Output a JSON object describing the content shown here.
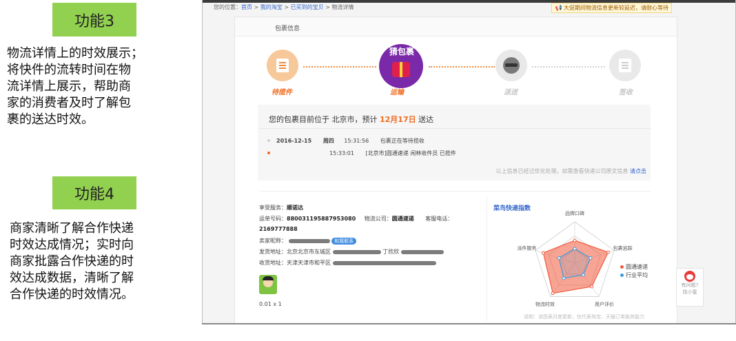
{
  "slides": {
    "feature3": {
      "badge": "功能3",
      "lines": [
        "物流详情上的时效展示；",
        "将快件的流转时间在物",
        "流详情上展示，帮助商",
        "家的消费者及时了解包",
        "裹的送达时效。"
      ]
    },
    "feature4": {
      "badge": "功能4",
      "lines": [
        "商家清晰了解合作快递",
        "时效达成情况；实时向",
        "商家批露合作快递的时",
        "效达成数据，清晰了解",
        "合作快递的时效情况。"
      ]
    }
  },
  "screenshot": {
    "breadcrumb": {
      "prefix": "您的位置：",
      "home": "首页",
      "sep": " > ",
      "mytaobao": "我的淘宝",
      "bought": "已买到的宝贝",
      "current": "物流详情"
    },
    "notice": "大促期间物流信息更新较延迟，请耐心等待",
    "panel_title": "包裹信息",
    "steps": [
      {
        "label": "待揽件",
        "state": "done",
        "icon": "clipboard-icon"
      },
      {
        "label": "运输",
        "state": "current",
        "icon": "gift-package-icon",
        "title": "猜包裹"
      },
      {
        "label": "派送",
        "state": "pending",
        "icon": "courier-icon"
      },
      {
        "label": "签收",
        "state": "pending",
        "icon": "signed-document-icon"
      }
    ],
    "eta": {
      "prefix": "您的包裹目前位于 北京市，预计 ",
      "date": "12月17日",
      "suffix": " 送达"
    },
    "tracking": [
      {
        "date": "2016-12-15",
        "weekday": "周四",
        "time": "15:31:56",
        "event": "包裹正在等待揽收"
      },
      {
        "date": "",
        "weekday": "",
        "time": "15:33:01",
        "event": "[北京市]圆通速递 闲林收件员 已揽件"
      }
    ],
    "tracking_note": "以上信息已经过优化处理，如需查看快递公司原文信息",
    "tracking_note_link": "请点击",
    "info": {
      "service_label": "享受服务：",
      "service_value": "顺诺达",
      "waybill_label": "运单号码：",
      "waybill_value": "880031195887953080",
      "company_label": "物流公司：",
      "company_value": "圆通速递",
      "phone_label": "客服电话：",
      "phone_value": "2169777888",
      "seller_label": "卖家昵称：",
      "contact_pill": "和我联系",
      "ship_label": "发货地址：",
      "ship_value": "北京北京市东城区",
      "ship_contact": "丁欣欣",
      "recv_label": "收货地址：",
      "recv_value": "天津天津市和平区",
      "qty": "0.01 x 1"
    },
    "radar": {
      "title": "菜鸟快递指数",
      "axes": [
        "品牌口碑",
        "包裹追踪",
        "用户评价",
        "物流时效",
        "派件服务"
      ],
      "series": [
        {
          "name": "圆通速递",
          "color": "#f05a3c",
          "values": [
            0.55,
            0.85,
            0.7,
            0.9,
            0.8
          ]
        },
        {
          "name": "行业平均",
          "color": "#3b9ad9",
          "values": [
            0.35,
            0.4,
            0.35,
            0.45,
            0.4
          ]
        }
      ],
      "footnote": "说明：该图表月度更新，仅代表淘宝、天猫订单服务能力"
    },
    "help": {
      "line1": "有问题?",
      "line2": "找小蜜"
    }
  }
}
